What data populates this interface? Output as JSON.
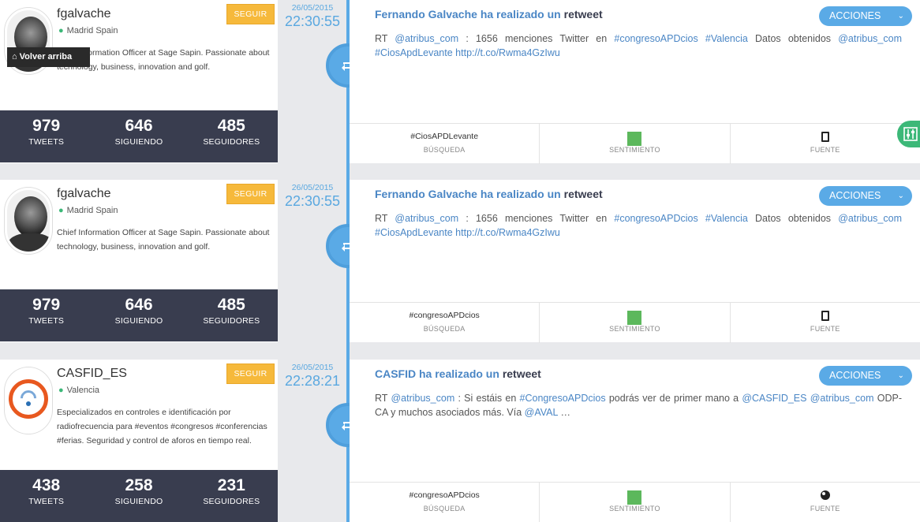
{
  "back_to_top": {
    "label": "Volver arriba",
    "icon": "home-icon"
  },
  "tweets": [
    {
      "username": "fgalvache",
      "location": "Madrid Spain",
      "bio": "Chief Information Officer at Sage Sapin. Passionate about technology, business, innovation and golf.",
      "follow_label": "SEGUIR",
      "stats": {
        "tweets": "979",
        "tweets_label": "TWEETS",
        "following": "646",
        "following_label": "SIGUIENDO",
        "followers": "485",
        "followers_label": "SEGUIDORES"
      },
      "date": "26/05/2015",
      "time": "22:30:55",
      "title": "Fernando Galvache ha realizado un",
      "action": "retweet",
      "actions_label": "ACCIONES",
      "text": {
        "p1": "RT ",
        "l1": "@atribus_com",
        "p2": " : 1656 menciones Twitter en ",
        "l2": "#congresoAPDcios",
        "p3": " ",
        "l3": "#Valencia",
        "p4": " Datos obtenidos ",
        "l4": "@atribus_com",
        "p5": " ",
        "l5": "#CiosApdLevante",
        "p6": " ",
        "l6": "http://t.co/Rwma4GzIwu",
        "p7": ""
      },
      "search": "#CiosAPDLevante",
      "search_label": "BÚSQUEDA",
      "sentiment_label": "SENTIMIENTO",
      "source_label": "FUENTE",
      "source_icon": "mobile-phone-icon",
      "sentiment_color": "#5cb85c"
    },
    {
      "username": "fgalvache",
      "location": "Madrid Spain",
      "bio": "Chief Information Officer at Sage Sapin. Passionate about technology, business, innovation and golf.",
      "follow_label": "SEGUIR",
      "stats": {
        "tweets": "979",
        "tweets_label": "TWEETS",
        "following": "646",
        "following_label": "SIGUIENDO",
        "followers": "485",
        "followers_label": "SEGUIDORES"
      },
      "date": "26/05/2015",
      "time": "22:30:55",
      "title": "Fernando Galvache ha realizado un",
      "action": "retweet",
      "actions_label": "ACCIONES",
      "text": {
        "p1": "RT ",
        "l1": "@atribus_com",
        "p2": " : 1656 menciones Twitter en ",
        "l2": "#congresoAPDcios",
        "p3": " ",
        "l3": "#Valencia",
        "p4": " Datos obtenidos ",
        "l4": "@atribus_com",
        "p5": " ",
        "l5": "#CiosApdLevante",
        "p6": " ",
        "l6": "http://t.co/Rwma4GzIwu",
        "p7": ""
      },
      "search": "#congresoAPDcios",
      "search_label": "BÚSQUEDA",
      "sentiment_label": "SENTIMIENTO",
      "source_label": "FUENTE",
      "source_icon": "mobile-phone-icon",
      "sentiment_color": "#5cb85c"
    },
    {
      "username": "CASFID_ES",
      "location": "Valencia",
      "bio": "Especializados en controles e identificación por radiofrecuencia para #eventos #congresos #conferencias #ferias. Seguridad y control de aforos en tiempo real.",
      "follow_label": "SEGUIR",
      "stats": {
        "tweets": "438",
        "tweets_label": "TWEETS",
        "following": "258",
        "following_label": "SIGUIENDO",
        "followers": "231",
        "followers_label": "SEGUIDORES"
      },
      "date": "26/05/2015",
      "time": "22:28:21",
      "title": "CASFID ha realizado un",
      "action": "retweet",
      "actions_label": "ACCIONES",
      "text": {
        "p1": "RT ",
        "l1": "@atribus_com",
        "p2": " : Si estáis en ",
        "l2": "#CongresoAPDcios",
        "p3": " podrás ver de primer mano a ",
        "l3": "@CASFID_ES",
        "p4": " ",
        "l4": "@atribus_com",
        "p5": " ODP-CA y muchos asociados más. Vía ",
        "l5": "@AVAL",
        "p6": " …",
        "l6": "",
        "p7": ""
      },
      "search": "#congresoAPDcios",
      "search_label": "BÚSQUEDA",
      "sentiment_label": "SENTIMIENTO",
      "source_label": "FUENTE",
      "source_icon": "web-globe-icon",
      "sentiment_color": "#5cb85c"
    }
  ]
}
